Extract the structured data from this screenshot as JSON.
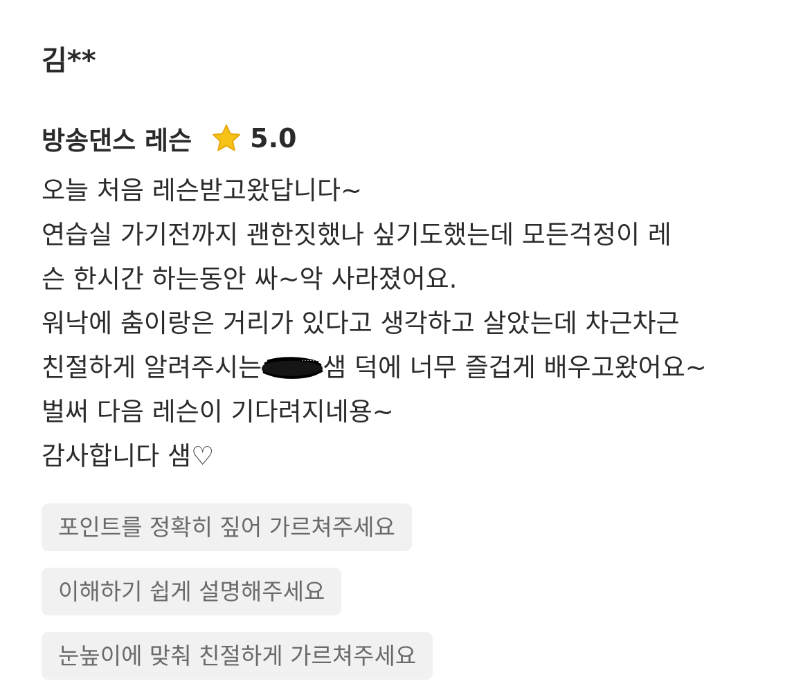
{
  "review": {
    "author": "김**",
    "class_name": "방송댄스 레슨",
    "rating": "5.0",
    "rating_icon": "star-icon",
    "star_color": "#f7c317",
    "lines": [
      "오늘 처음 레슨받고왔답니다~",
      "연습실 가기전까지 괜한짓했나 싶기도했는데 모든걱정이 레",
      "슨 한시간 하는동안 싸~악 사라졌어요.",
      "워낙에 춤이랑은 거리가 있다고 생각하고 살았는데 차근차근",
      "친절하게 알려주시는",
      "샘 덕에 너무 즐겁게 배우고왔어요~",
      "벌써 다음 레슨이 기다려지네용~",
      "감사합니다 샘♡"
    ],
    "tags": [
      "포인트를 정확히 짚어 가르쳐주세요",
      "이해하기 쉽게 설명해주세요",
      "눈높이에 맞춰 친절하게 가르쳐주세요"
    ]
  }
}
